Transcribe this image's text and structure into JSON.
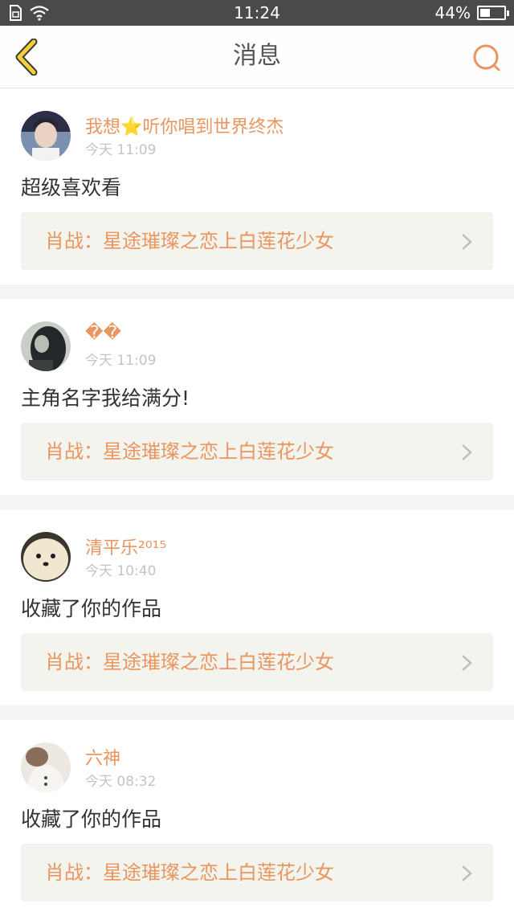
{
  "status_bar": {
    "time": "11:24",
    "battery": "44%",
    "battery_level": 0.44
  },
  "header": {
    "title": "消息",
    "accent_color": "#e8955f",
    "back_icon_color": "#e8c13a"
  },
  "messages": [
    {
      "username": "我想⭐听你唱到世界终杰",
      "time": "今天 11:09",
      "text": "超级喜欢看",
      "work_title": "肖战：星途璀璨之恋上白莲花少女"
    },
    {
      "username": "��",
      "time": "今天 11:09",
      "text": "主角名字我给满分!",
      "work_title": "肖战：星途璀璨之恋上白莲花少女"
    },
    {
      "username": "清平乐²⁰¹⁵",
      "time": "今天 10:40",
      "text": "收藏了你的作品",
      "work_title": "肖战：星途璀璨之恋上白莲花少女"
    },
    {
      "username": "六神",
      "time": "今天 08:32",
      "text": "收藏了你的作品",
      "work_title": "肖战：星途璀璨之恋上白莲花少女"
    }
  ]
}
